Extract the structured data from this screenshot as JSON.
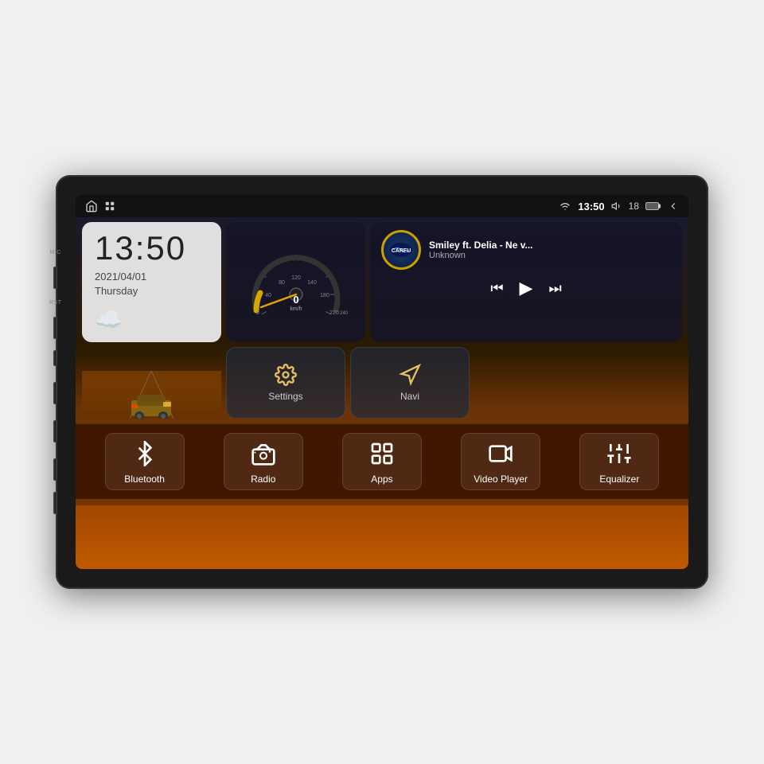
{
  "device": {
    "background": "#f0f0f0"
  },
  "status_bar": {
    "time": "13:50",
    "volume": "18",
    "home_label": "home",
    "apps_label": "apps",
    "wifi_signal": "wifi",
    "battery": "battery",
    "back": "back"
  },
  "clock": {
    "time": "13:50",
    "date": "2021/04/01",
    "day": "Thursday"
  },
  "music": {
    "title": "Smiley ft. Delia - Ne v...",
    "artist": "Unknown",
    "logo_text": "CARFU"
  },
  "speed": {
    "value": "0",
    "unit": "km/h"
  },
  "quick_actions": [
    {
      "id": "settings",
      "label": "Settings",
      "icon": "gear"
    },
    {
      "id": "navi",
      "label": "Navi",
      "icon": "navigation"
    }
  ],
  "app_bar": [
    {
      "id": "bluetooth",
      "label": "Bluetooth",
      "icon": "bluetooth"
    },
    {
      "id": "radio",
      "label": "Radio",
      "icon": "radio"
    },
    {
      "id": "apps",
      "label": "Apps",
      "icon": "apps"
    },
    {
      "id": "video_player",
      "label": "Video Player",
      "icon": "video"
    },
    {
      "id": "equalizer",
      "label": "Equalizer",
      "icon": "equalizer"
    }
  ],
  "weather": {
    "icon": "☁️"
  }
}
